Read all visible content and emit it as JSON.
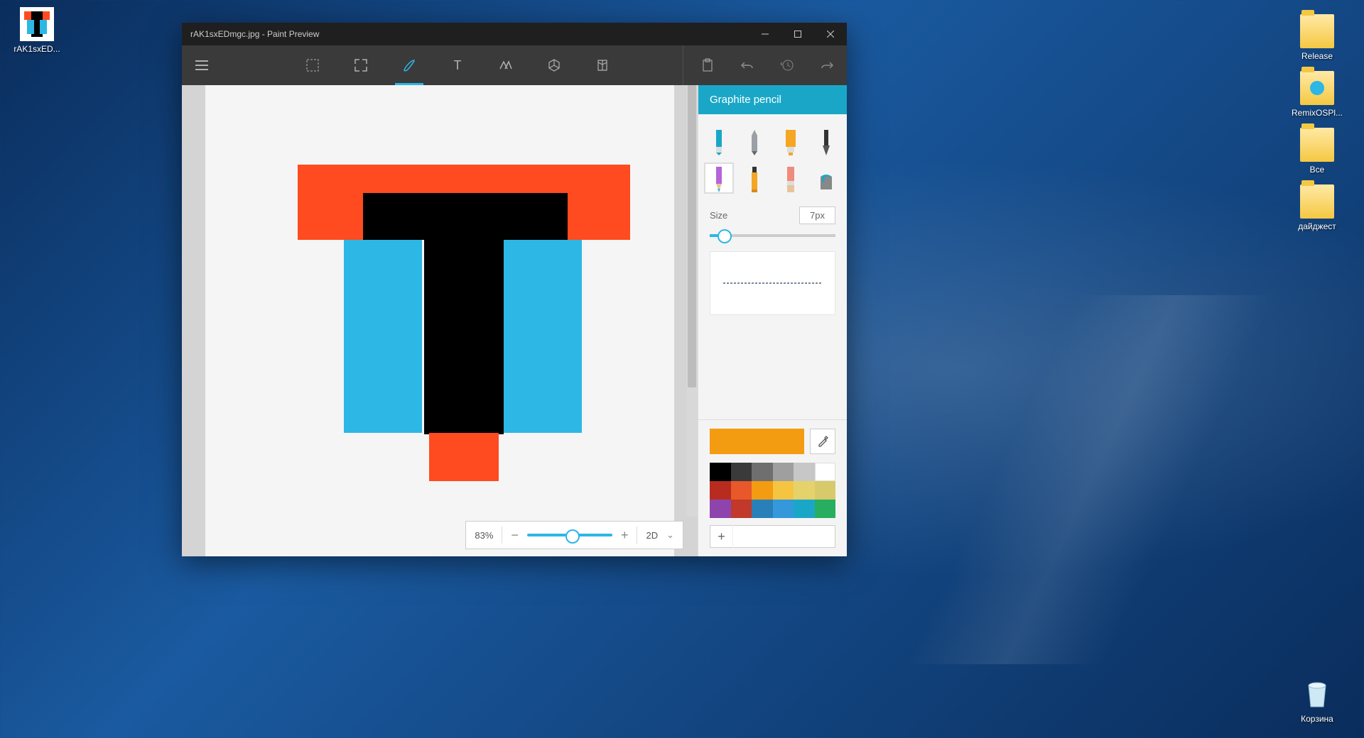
{
  "desktop": {
    "icons_left": [
      {
        "label": "rAK1sxED..."
      }
    ],
    "icons_right": [
      {
        "label": "Release"
      },
      {
        "label": "RemixOSPl..."
      },
      {
        "label": "Все"
      },
      {
        "label": "дайджест"
      }
    ],
    "recycle_bin": "Корзина"
  },
  "window": {
    "title": "rAK1sxEDmgc.jpg - Paint Preview",
    "toolbar": {
      "menu": "menu",
      "tools": [
        "select",
        "crop",
        "brush",
        "text",
        "stamp",
        "3d",
        "fold"
      ],
      "active": "brush",
      "right": [
        "paste",
        "undo",
        "history",
        "redo"
      ]
    },
    "zoom": {
      "percent": "83%",
      "mode": "2D"
    },
    "sidebar": {
      "header": "Graphite pencil",
      "size_label": "Size",
      "size_value": "7px",
      "current_color": "#f39c12",
      "palette": [
        "#000000",
        "#3a3a3a",
        "#6f6f6f",
        "#9f9f9f",
        "#c7c7c7",
        "#ffffff",
        "#b82c1f",
        "#e8582a",
        "#f39c12",
        "#f5c542",
        "#e5d26a",
        "#d8c96a",
        "#8e44ad",
        "#c0392b",
        "#2980b9",
        "#3498db",
        "#1aa7c7",
        "#27ae60"
      ]
    }
  }
}
